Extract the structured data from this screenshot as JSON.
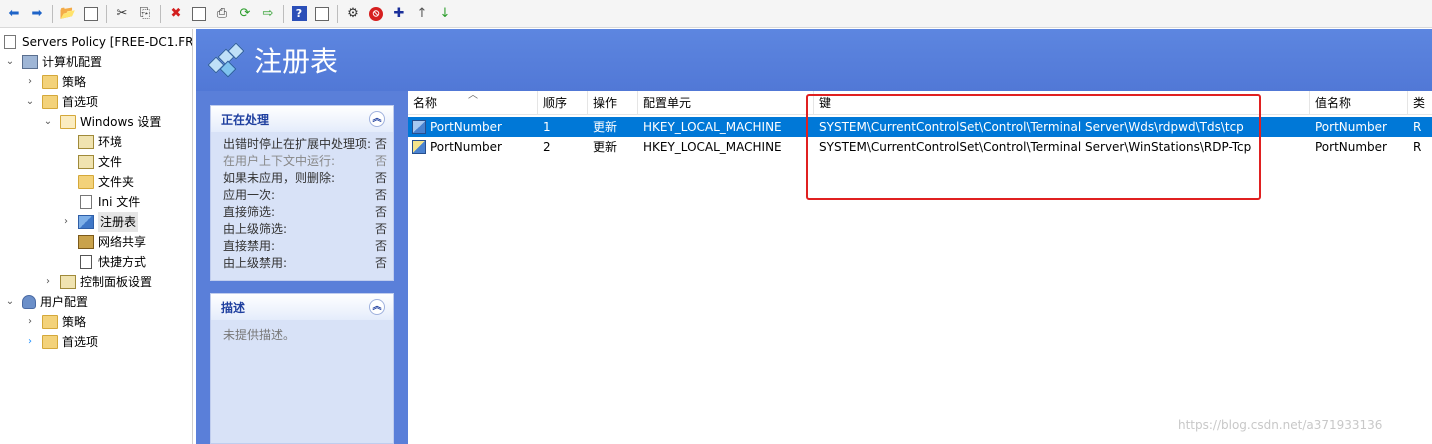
{
  "toolbar": {
    "items": [
      "back-icon",
      "forward-icon",
      "up-folder-icon",
      "show-hide-tree-icon",
      "cut-icon",
      "copy-icon",
      "delete-icon",
      "properties-icon",
      "print-icon",
      "refresh-icon",
      "export-icon",
      "help-icon",
      "view-icon",
      "new-item-icon",
      "stop-icon",
      "add-icon",
      "move-up-icon",
      "move-down-icon"
    ]
  },
  "tree": {
    "root": "Servers Policy [FREE-DC1.FRE",
    "computer_config": "计算机配置",
    "policies": "策略",
    "preferences": "首选项",
    "windows_settings": "Windows 设置",
    "env": "环境",
    "files": "文件",
    "folders": "文件夹",
    "ini_files": "Ini 文件",
    "registry": "注册表",
    "network_shares": "网络共享",
    "shortcuts": "快捷方式",
    "control_panel": "控制面板设置",
    "user_config": "用户配置",
    "user_policies": "策略",
    "user_preferences": "首选项"
  },
  "main": {
    "title": "注册表"
  },
  "processing_panel": {
    "title": "正在处理",
    "rows": [
      {
        "label": "出错时停止在扩展中处理项:",
        "value": "否",
        "dim": false
      },
      {
        "label": "在用户上下文中运行:",
        "value": "否",
        "dim": true
      },
      {
        "label": "如果未应用，则删除:",
        "value": "否",
        "dim": false
      },
      {
        "label": "应用一次:",
        "value": "否",
        "dim": false
      },
      {
        "label": "直接筛选:",
        "value": "否",
        "dim": false
      },
      {
        "label": "由上级筛选:",
        "value": "否",
        "dim": false
      },
      {
        "label": "直接禁用:",
        "value": "否",
        "dim": false
      },
      {
        "label": "由上级禁用:",
        "value": "否",
        "dim": false
      }
    ]
  },
  "description_panel": {
    "title": "描述",
    "text": "未提供描述。"
  },
  "list": {
    "columns": [
      "名称",
      "顺序",
      "操作",
      "配置单元",
      "键",
      "值名称",
      "类"
    ],
    "rows": [
      {
        "name": "PortNumber",
        "order": "1",
        "action": "更新",
        "hive": "HKEY_LOCAL_MACHINE",
        "key": "SYSTEM\\CurrentControlSet\\Control\\Terminal Server\\Wds\\rdpwd\\Tds\\tcp",
        "value_name": "PortNumber",
        "type": "R"
      },
      {
        "name": "PortNumber",
        "order": "2",
        "action": "更新",
        "hive": "HKEY_LOCAL_MACHINE",
        "key": "SYSTEM\\CurrentControlSet\\Control\\Terminal Server\\WinStations\\RDP-Tcp",
        "value_name": "PortNumber",
        "type": "R"
      }
    ]
  },
  "watermark": "https://blog.csdn.net/a371933136",
  "colors": {
    "header_blue": "#5a7fd9",
    "selection": "#0078d7",
    "highlight_red": "#e02020"
  }
}
